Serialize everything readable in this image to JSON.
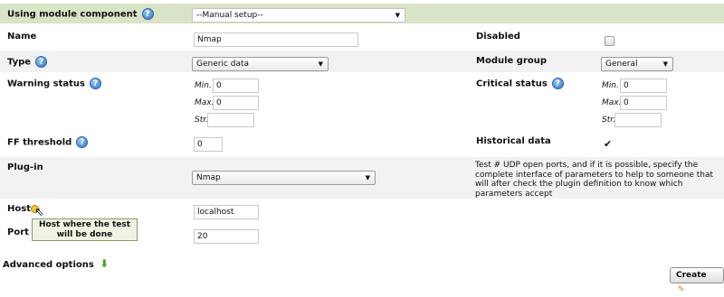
{
  "header": {
    "label": "Using module component",
    "select_value": "--Manual setup--",
    "background": "#d9e3c6"
  },
  "fields": {
    "name_label": "Name",
    "name_value": "Nmap",
    "disabled_label": "Disabled",
    "type_label": "Type",
    "type_value": "Generic data",
    "module_group_label": "Module group",
    "module_group_value": "General",
    "warning_label": "Warning status",
    "critical_label": "Critical status",
    "min_label": "Min.",
    "max_label": "Max.",
    "str_label": "Str.",
    "warning_min": "0",
    "warning_max": "0",
    "warning_str": "",
    "critical_min": "0",
    "critical_max": "0",
    "critical_str": "",
    "ff_label": "FF threshold",
    "ff_value": "0",
    "historical_label": "Historical data",
    "plugin_label": "Plug-in",
    "plugin_value": "Nmap",
    "plugin_description": "Test # UDP open ports, and if it is possible, specify the complete interface of parameters to help to someone that will after check the plugin definition to know which parameters accept",
    "host_label": "Host",
    "host_value": "localhost",
    "host_tooltip": "Host where the test will be done",
    "port_label": "Port",
    "port_value": "20"
  },
  "footer": {
    "advanced_label": "Advanced options",
    "create_label": "Create"
  },
  "icons": {
    "help": "help-icon",
    "arrow_down": "green-arrow-down-icon",
    "wand": "wand-icon"
  }
}
